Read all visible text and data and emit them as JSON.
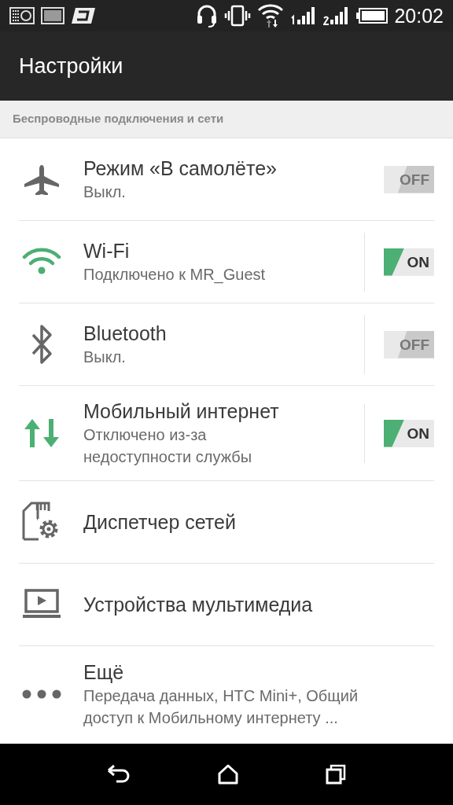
{
  "status_bar": {
    "time": "20:02"
  },
  "app_bar": {
    "title": "Настройки"
  },
  "section": {
    "header": "Беспроводные подключения и сети"
  },
  "items": [
    {
      "kind": "toggle",
      "title": "Режим «В самолёте»",
      "subtitle": "Выкл.",
      "on": false,
      "toggle_label": "OFF",
      "split": false
    },
    {
      "kind": "toggle",
      "title": "Wi-Fi",
      "subtitle": "Подключено к MR_Guest",
      "on": true,
      "toggle_label": "ON",
      "split": true
    },
    {
      "kind": "toggle",
      "title": "Bluetooth",
      "subtitle": "Выкл.",
      "on": false,
      "toggle_label": "OFF",
      "split": true
    },
    {
      "kind": "toggle",
      "title": "Мобильный интернет",
      "subtitle": "Отключено из-за недоступности службы",
      "on": true,
      "toggle_label": "ON",
      "split": true
    },
    {
      "kind": "link",
      "title": "Диспетчер сетей"
    },
    {
      "kind": "link",
      "title": "Устройства мультимедиа"
    },
    {
      "kind": "link",
      "title": "Ещё",
      "subtitle": "Передача данных, HTC Mini+, Общий доступ к Мобильному интернету ..."
    }
  ]
}
